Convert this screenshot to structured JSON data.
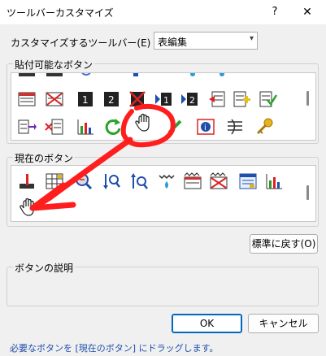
{
  "window": {
    "title": "ツールバーカスタマイズ",
    "help_glyph": "?",
    "close_glyph": "✕"
  },
  "toolbar_select": {
    "label": "カスタマイズするツールバー(E) :",
    "value": "表編集"
  },
  "available_buttons": {
    "label": "貼付可能なボタン"
  },
  "current_buttons": {
    "label": "現在のボタン"
  },
  "reset_button": {
    "label": "標準に戻す(O)"
  },
  "description": {
    "label": "ボタンの説明",
    "text": ""
  },
  "ok_button": {
    "label": "OK"
  },
  "cancel_button": {
    "label": "キャンセル"
  },
  "status_bar": {
    "text": "必要なボタンを [現在のボタン] にドラッグします。"
  },
  "colors": {
    "annotation": "#ff1e1e",
    "link_text": "#1f4eab",
    "accent": "#0067c0"
  }
}
